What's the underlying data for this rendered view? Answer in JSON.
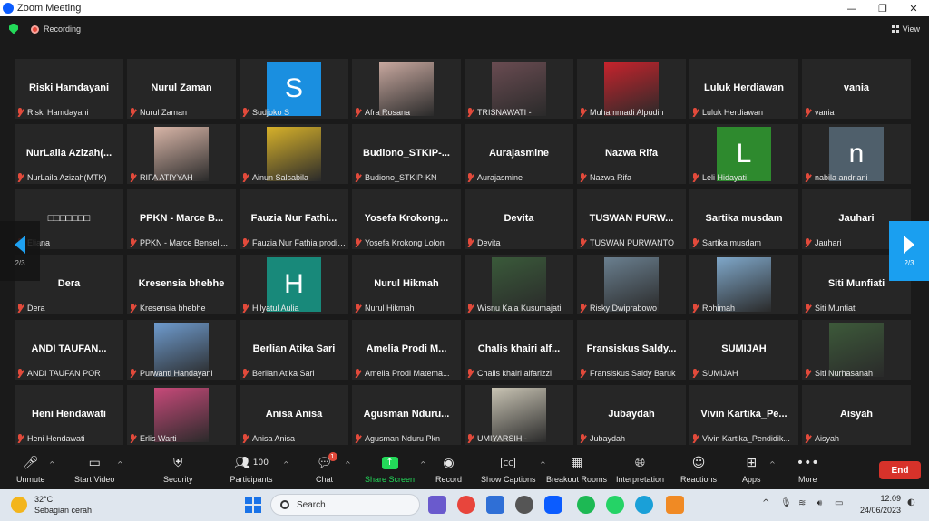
{
  "window": {
    "title": "Zoom Meeting",
    "controls": [
      "—",
      "❐",
      "✕"
    ]
  },
  "topbar": {
    "recording_label": "Recording",
    "view_label": "View"
  },
  "participants": [
    {
      "display": "Riski Hamdayani",
      "name": "Riski Hamdayani",
      "kind": "text"
    },
    {
      "display": "Nurul Zaman",
      "name": "Nurul Zaman",
      "kind": "text"
    },
    {
      "display": "S",
      "name": "Sudjoko S",
      "kind": "avatar",
      "color": "#1a8fe0"
    },
    {
      "display": "",
      "name": "Afra Rosana",
      "kind": "photo",
      "color": "#c9a9a0"
    },
    {
      "display": "",
      "name": "TRISNAWATI -",
      "kind": "photo",
      "color": "#6a4c52"
    },
    {
      "display": "",
      "name": "Muhammadi Alpudin",
      "kind": "photo",
      "color": "#c8232c"
    },
    {
      "display": "Luluk Herdiawan",
      "name": "Luluk Herdiawan",
      "kind": "text"
    },
    {
      "display": "vania",
      "name": "vania",
      "kind": "text"
    },
    {
      "display": "NurLaila Azizah(...",
      "name": "NurLaila Azizah(MTK)",
      "kind": "text"
    },
    {
      "display": "",
      "name": "RIFA ATIYYAH",
      "kind": "photo",
      "color": "#d9b6a8"
    },
    {
      "display": "",
      "name": "Ainun Salsabila",
      "kind": "photo",
      "color": "#d8b22a"
    },
    {
      "display": "Budiono_STKIP-...",
      "name": "Budiono_STKIP-KN",
      "kind": "text"
    },
    {
      "display": "Aurajasmine",
      "name": "Aurajasmine",
      "kind": "text"
    },
    {
      "display": "Nazwa Rifa",
      "name": "Nazwa Rifa",
      "kind": "text"
    },
    {
      "display": "L",
      "name": "Leli Hidayati",
      "kind": "avatar",
      "color": "#2e8a2e"
    },
    {
      "display": "n",
      "name": "nabila andriani",
      "kind": "avatar",
      "color": "#4f5f6b"
    },
    {
      "display": "□□□□□□□",
      "name": "Eliana",
      "kind": "text"
    },
    {
      "display": "PPKN - Marce B...",
      "name": "PPKN - Marce Benseli...",
      "kind": "text"
    },
    {
      "display": "Fauzia Nur Fathi...",
      "name": "Fauzia Nur Fathia prodi ...",
      "kind": "text"
    },
    {
      "display": "Yosefa Krokong...",
      "name": "Yosefa Krokong Lolon",
      "kind": "text"
    },
    {
      "display": "Devita",
      "name": "Devita",
      "kind": "text"
    },
    {
      "display": "TUSWAN PURW...",
      "name": "TUSWAN PURWANTO",
      "kind": "text"
    },
    {
      "display": "Sartika musdam",
      "name": "Sartika musdam",
      "kind": "text"
    },
    {
      "display": "Jauhari",
      "name": "Jauhari",
      "kind": "text"
    },
    {
      "display": "Dera",
      "name": "Dera",
      "kind": "text"
    },
    {
      "display": "Kresensia bhebhe",
      "name": "Kresensia bhebhe",
      "kind": "text"
    },
    {
      "display": "H",
      "name": "Hilyatul Aulia",
      "kind": "avatar",
      "color": "#18897a"
    },
    {
      "display": "Nurul Hikmah",
      "name": "Nurul Hikmah",
      "kind": "text"
    },
    {
      "display": "",
      "name": "Wisnu Kala Kusumajati",
      "kind": "photo",
      "color": "#3a5a3a"
    },
    {
      "display": "",
      "name": "Risky Dwiprabowo",
      "kind": "photo",
      "color": "#6a7f8f"
    },
    {
      "display": "",
      "name": "Rohimah",
      "kind": "photo",
      "color": "#7fa7c9"
    },
    {
      "display": "Siti Munfiati",
      "name": "Siti Munfiati",
      "kind": "text"
    },
    {
      "display": "ANDI  TAUFAN...",
      "name": "ANDI  TAUFAN POR",
      "kind": "text"
    },
    {
      "display": "",
      "name": "Purwanti Handayani",
      "kind": "photo",
      "color": "#6f9ccf"
    },
    {
      "display": "Berlian Atika Sari",
      "name": "Berlian Atika Sari",
      "kind": "text"
    },
    {
      "display": "Amelia Prodi M...",
      "name": "Amelia Prodi Matema...",
      "kind": "text"
    },
    {
      "display": "Chalis khairi alf...",
      "name": "Chalis khairi alfarizzi",
      "kind": "text"
    },
    {
      "display": "Fransiskus  Saldy...",
      "name": "Fransiskus Saldy Baruk",
      "kind": "text"
    },
    {
      "display": "SUMIJAH",
      "name": "SUMIJAH",
      "kind": "text"
    },
    {
      "display": "",
      "name": "Siti Nurhasanah",
      "kind": "photo",
      "color": "#3d5a3a"
    },
    {
      "display": "Heni Hendawati",
      "name": "Heni Hendawati",
      "kind": "text"
    },
    {
      "display": "",
      "name": "Erlis Warti",
      "kind": "photo",
      "color": "#c84a7a"
    },
    {
      "display": "Anisa Anisa",
      "name": "Anisa Anisa",
      "kind": "text"
    },
    {
      "display": "Agusman  Nduru...",
      "name": "Agusman Nduru Pkn",
      "kind": "text"
    },
    {
      "display": "",
      "name": "UMIYARSIH -",
      "kind": "photo",
      "color": "#c9c4b4"
    },
    {
      "display": "Jubaydah",
      "name": "Jubaydah",
      "kind": "text"
    },
    {
      "display": "Vivin  Kartika_Pe...",
      "name": "Vivin Kartika_Pendidik...",
      "kind": "text"
    },
    {
      "display": "Aisyah",
      "name": "Aisyah",
      "kind": "text"
    }
  ],
  "pagination": {
    "left": "2/3",
    "right": "2/3"
  },
  "toolbar": {
    "unmute": "Unmute",
    "start_video": "Start Video",
    "security": "Security",
    "participants": "Participants",
    "participants_count": "100",
    "chat": "Chat",
    "chat_badge": "1",
    "share_screen": "Share Screen",
    "record": "Record",
    "show_captions": "Show Captions",
    "breakout_rooms": "Breakout Rooms",
    "interpretation": "Interpretation",
    "reactions": "Reactions",
    "apps": "Apps",
    "more": "More",
    "end": "End"
  },
  "taskbar": {
    "temperature": "32°C",
    "weather": "Sebagian cerah",
    "search_placeholder": "Search",
    "time": "12:09",
    "date": "24/06/2023"
  },
  "colors": {
    "share_green": "#23d959",
    "end_red": "#d7322a",
    "accent_blue": "#1a9ff0"
  }
}
